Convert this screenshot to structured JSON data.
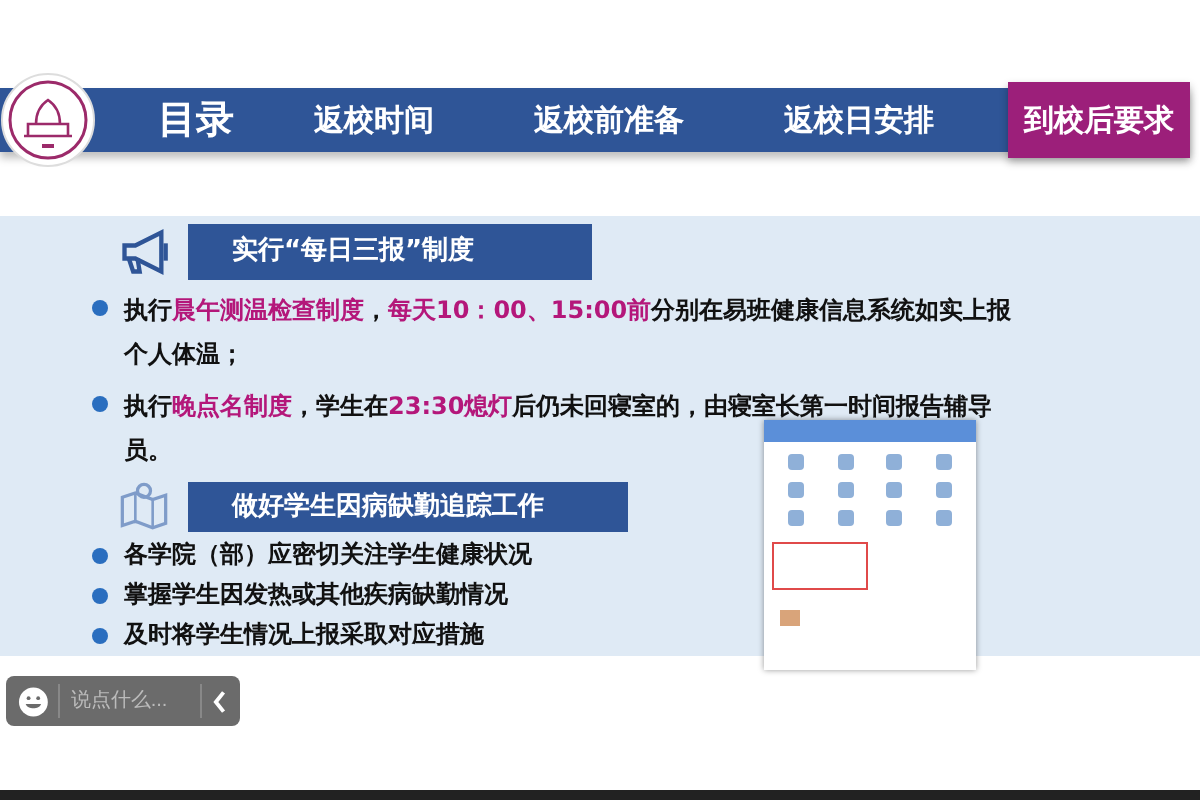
{
  "nav": {
    "items": [
      {
        "label": "目录",
        "selected": false
      },
      {
        "label": "返校时间",
        "selected": false
      },
      {
        "label": "返校前准备",
        "selected": false
      },
      {
        "label": "返校日安排",
        "selected": false
      },
      {
        "label": "到校后要求",
        "selected": true
      }
    ]
  },
  "sections": [
    {
      "heading": "实行“每日三报”制度",
      "kind": "megaphone",
      "bullets": [
        [
          {
            "text": "执行",
            "highlight": false
          },
          {
            "text": "晨午测温检查制度",
            "highlight": true
          },
          {
            "text": "，",
            "highlight": false
          },
          {
            "text": "每天10：00、15:00前",
            "highlight": true
          },
          {
            "text": "分别在易班健康信息系统如实上报个人体温；",
            "highlight": false
          }
        ],
        [
          {
            "text": "执行",
            "highlight": false
          },
          {
            "text": "晚点名制度",
            "highlight": true
          },
          {
            "text": "，学生在",
            "highlight": false
          },
          {
            "text": "23:30熄灯",
            "highlight": true
          },
          {
            "text": "后仍未回寝室的，由寝室长第一时间报告辅导员。",
            "highlight": false
          }
        ]
      ]
    },
    {
      "heading": "做好学生因病缺勤追踪工作",
      "kind": "map",
      "bullets": [
        [
          {
            "text": "各学院（部）应密切关注学生健康状况",
            "highlight": false
          }
        ],
        [
          {
            "text": "掌握学生因发热或其他疾病缺勤情况",
            "highlight": false
          }
        ],
        [
          {
            "text": "及时将学生情况上报采取对应措施",
            "highlight": false
          }
        ]
      ]
    }
  ],
  "chat": {
    "placeholder": "说点什么..."
  }
}
